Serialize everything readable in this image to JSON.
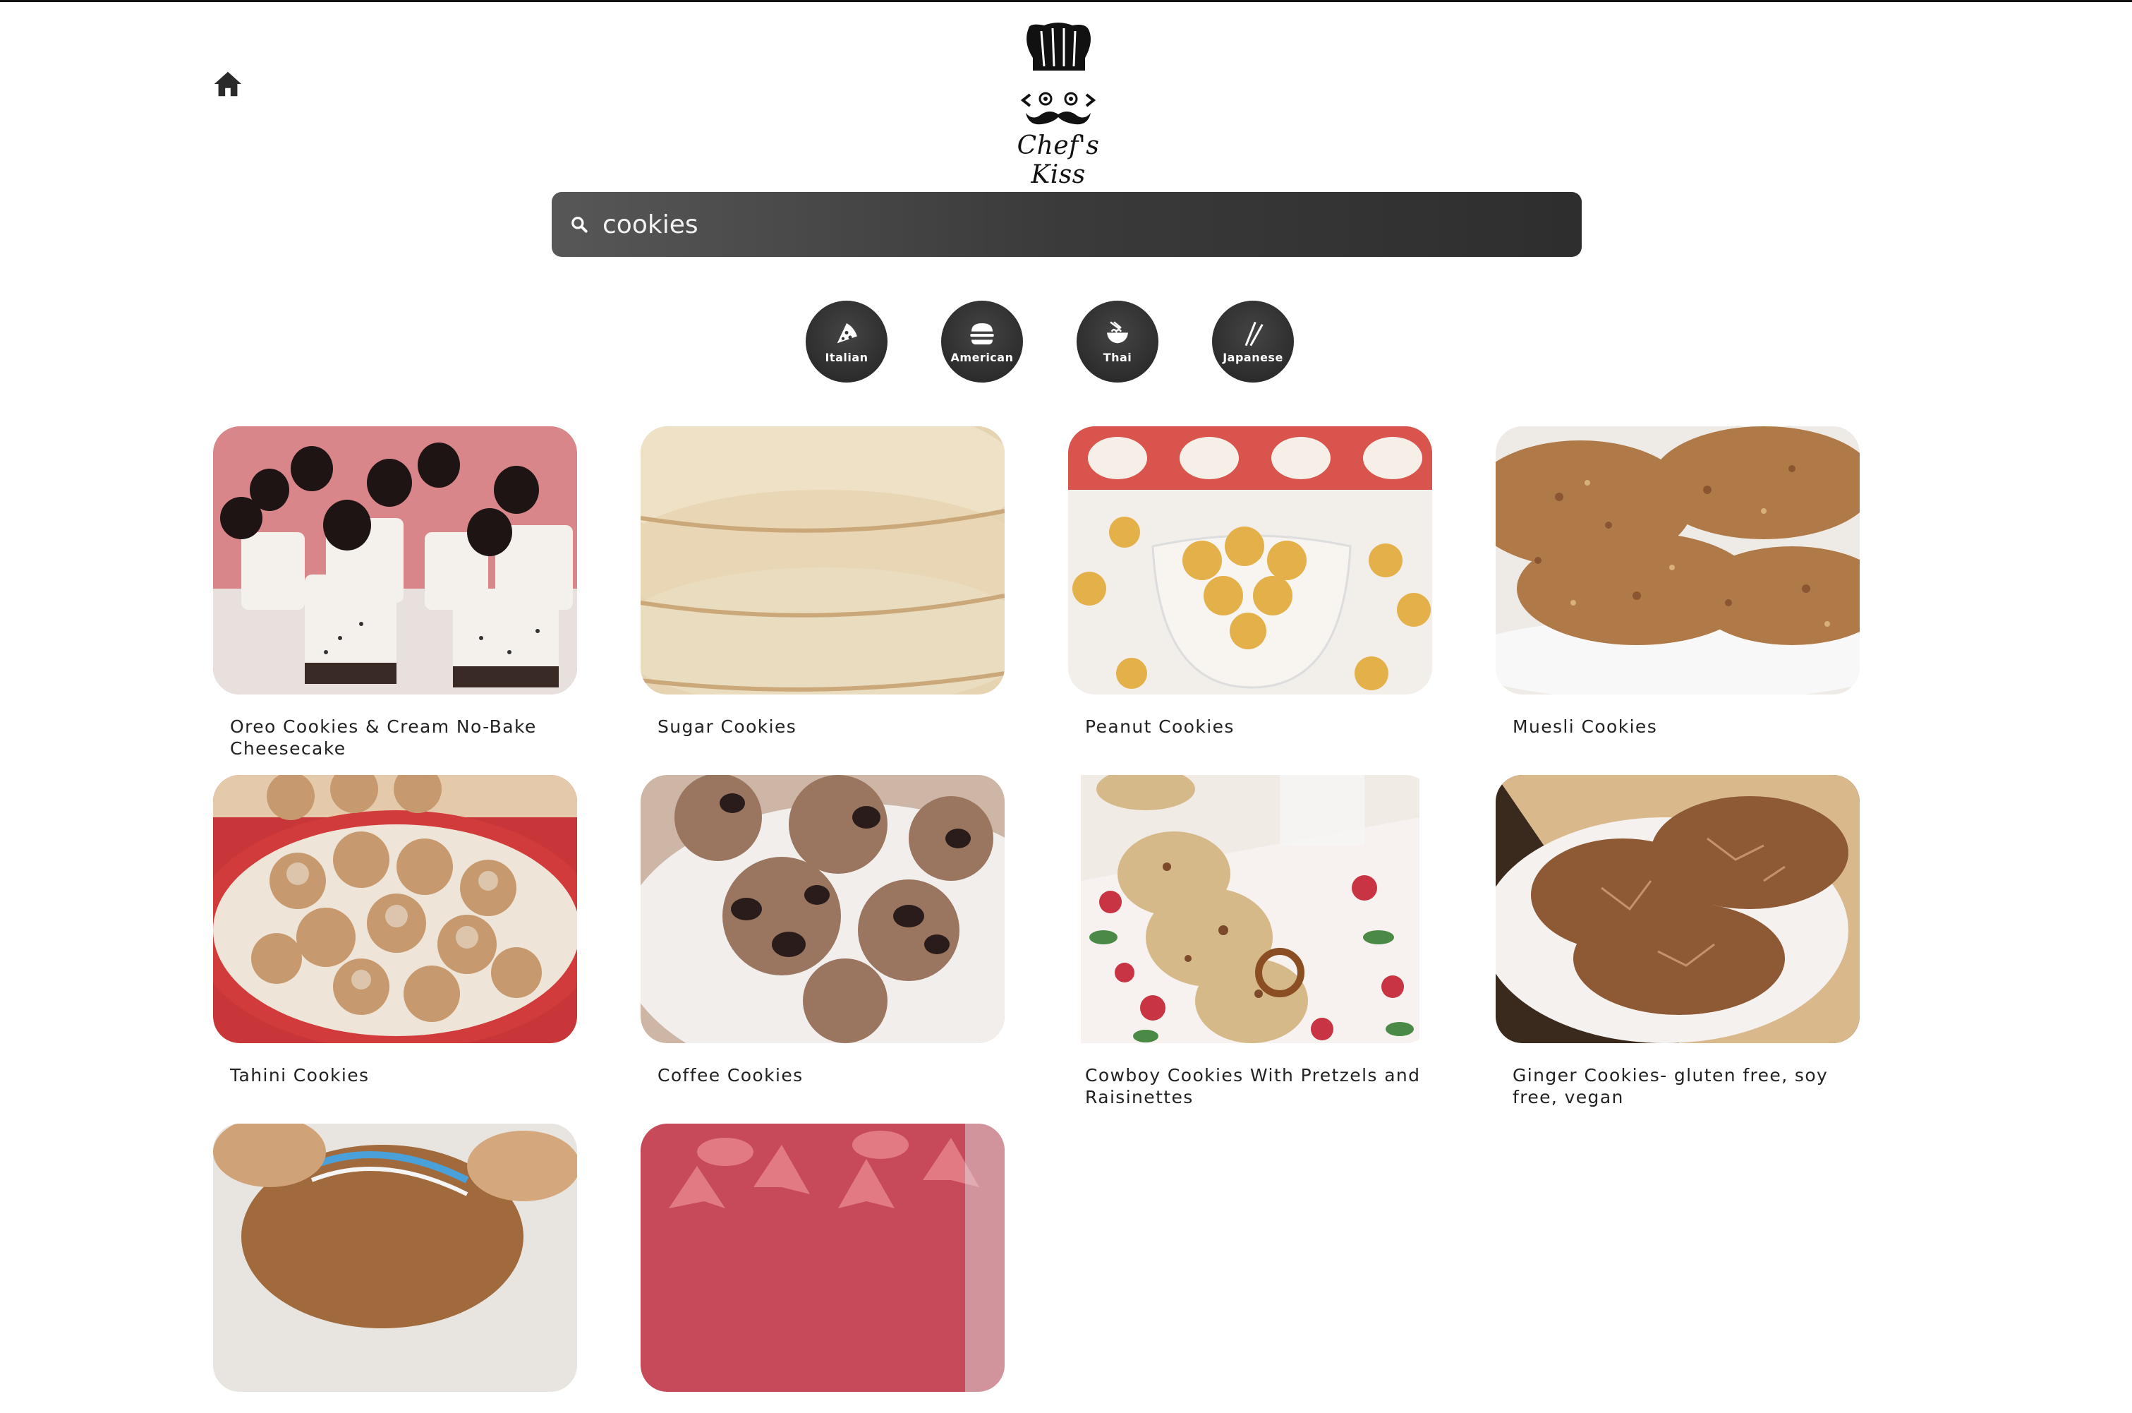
{
  "app": {
    "logo_text": "Chef's Kiss"
  },
  "nav": {
    "home_icon": "home-icon"
  },
  "search": {
    "value": "cookies",
    "icon": "search-icon"
  },
  "cuisines": [
    {
      "label": "Italian",
      "icon": "pizza-icon"
    },
    {
      "label": "American",
      "icon": "burger-icon"
    },
    {
      "label": "Thai",
      "icon": "noodle-bowl-icon"
    },
    {
      "label": "Japanese",
      "icon": "chopsticks-icon"
    }
  ],
  "recipes": [
    {
      "title": "Oreo Cookies & Cream No-Bake Cheesecake"
    },
    {
      "title": "Sugar Cookies"
    },
    {
      "title": "Peanut Cookies"
    },
    {
      "title": "Muesli Cookies"
    },
    {
      "title": "Tahini Cookies"
    },
    {
      "title": "Coffee Cookies"
    },
    {
      "title": "Cowboy Cookies With Pretzels and Raisinettes"
    },
    {
      "title": "Ginger Cookies- gluten free, soy free, vegan"
    },
    {
      "title": ""
    },
    {
      "title": ""
    }
  ],
  "colors": {
    "search_bg": "#3a3a3a",
    "cuisine_bg": "#2d2d2d",
    "text": "#222222"
  }
}
